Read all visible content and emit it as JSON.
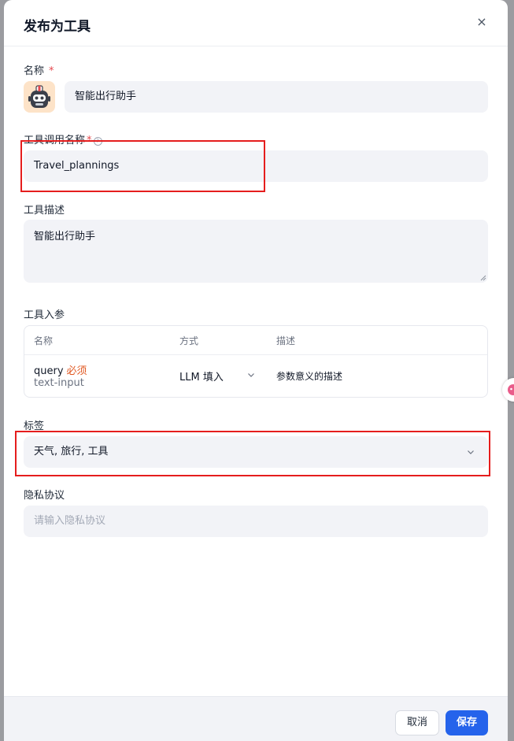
{
  "dialog": {
    "title": "发布为工具",
    "close_glyph": "×"
  },
  "name_field": {
    "label": "名称",
    "required_mark": "*",
    "value": "智能出行助手",
    "avatar_icon": "robot-avatar-icon"
  },
  "call_name_field": {
    "label": "工具调用名称",
    "required_mark": "*",
    "help_glyph": "?",
    "value": "Travel_plannings"
  },
  "description_field": {
    "label": "工具描述",
    "value": "智能出行助手"
  },
  "params": {
    "label": "工具入参",
    "headers": [
      "名称",
      "方式",
      "描述"
    ],
    "rows": [
      {
        "name": "query",
        "required_tag": "必须",
        "type": "text-input",
        "method": "LLM 填入",
        "description_placeholder": "参数意义的描述"
      }
    ]
  },
  "tags_field": {
    "label": "标签",
    "value": "天气, 旅行, 工具"
  },
  "privacy_field": {
    "label": "隐私协议",
    "placeholder": "请输入隐私协议"
  },
  "footer": {
    "cancel_label": "取消",
    "save_label": "保存"
  },
  "colors": {
    "primary": "#2563eb",
    "required": "#e5484d",
    "annotation": "#e51d1d",
    "input_bg": "#f2f3f7"
  }
}
